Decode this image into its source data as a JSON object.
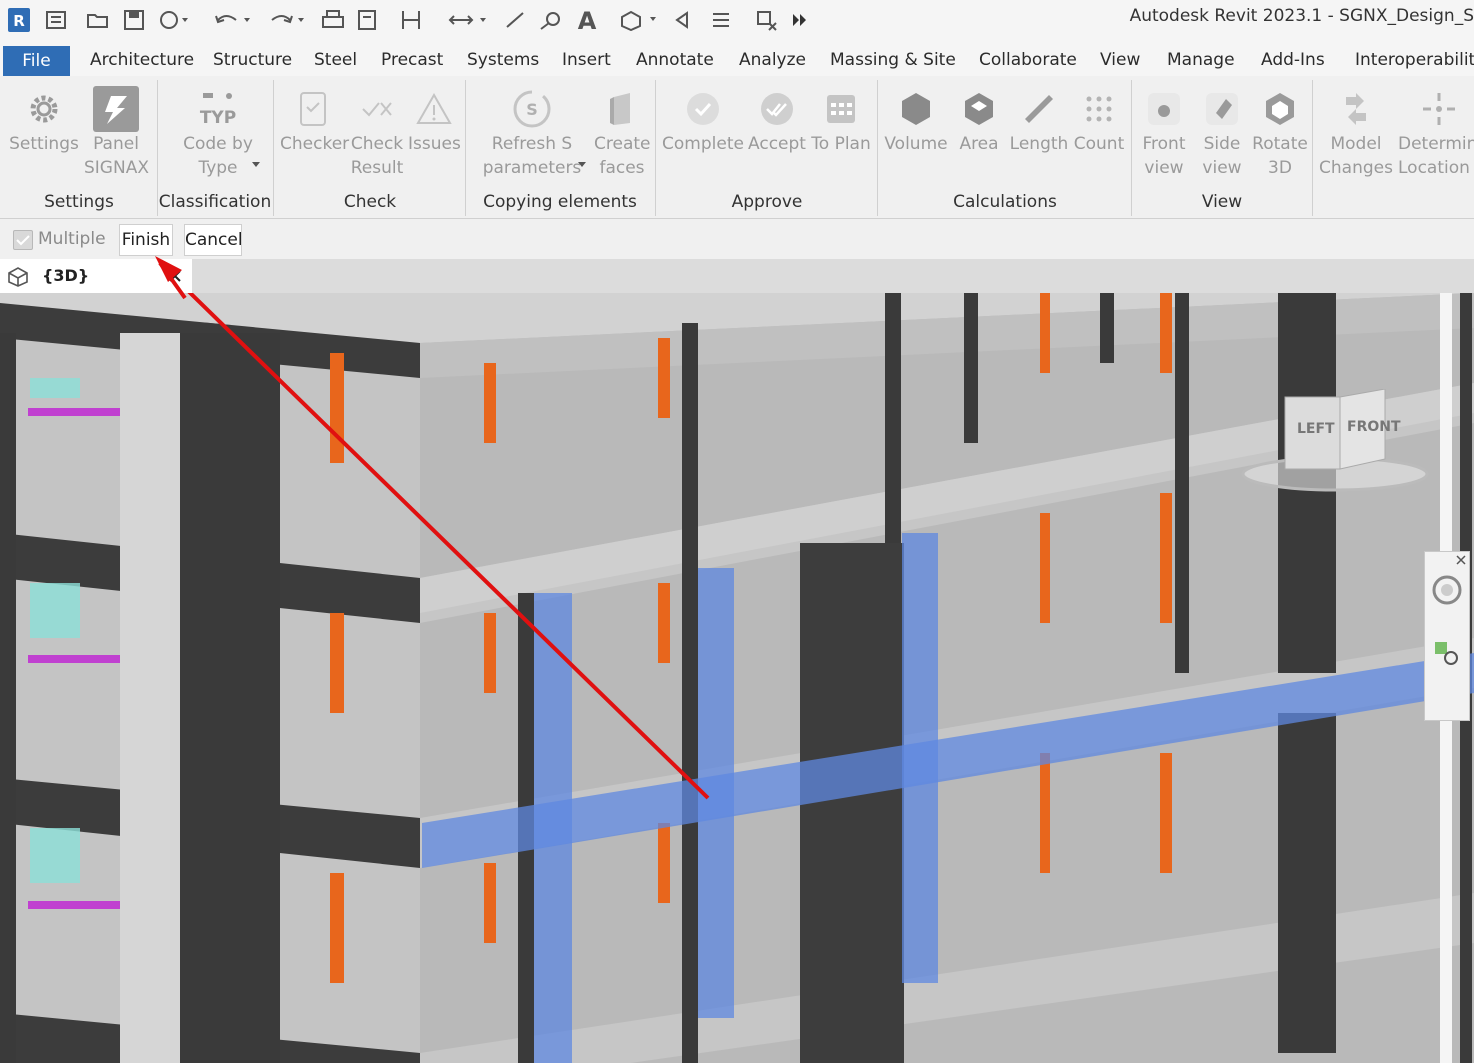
{
  "window": {
    "title": "Autodesk Revit 2023.1 - SGNX_Design_S"
  },
  "app_logo": "R",
  "menu": [
    {
      "label": "File"
    },
    {
      "label": "Architecture"
    },
    {
      "label": "Structure"
    },
    {
      "label": "Steel"
    },
    {
      "label": "Precast"
    },
    {
      "label": "Systems"
    },
    {
      "label": "Insert"
    },
    {
      "label": "Annotate"
    },
    {
      "label": "Analyze"
    },
    {
      "label": "Massing & Site"
    },
    {
      "label": "Collaborate"
    },
    {
      "label": "View"
    },
    {
      "label": "Manage"
    },
    {
      "label": "Add-Ins"
    },
    {
      "label": "Interoperability"
    }
  ],
  "ribbon": {
    "panels": [
      {
        "title": "Settings"
      },
      {
        "title": "Classification"
      },
      {
        "title": "Check"
      },
      {
        "title": "Copying elements"
      },
      {
        "title": "Approve"
      },
      {
        "title": "Calculations"
      },
      {
        "title": "View"
      }
    ],
    "tools": [
      {
        "line1": "Settings",
        "line2": "",
        "icon": "gear-icon"
      },
      {
        "line1": "Panel",
        "line2": "SIGNAX",
        "icon": "signax-logo-icon"
      },
      {
        "line1": "Code by",
        "line2": "Type",
        "icon": "typ-icon"
      },
      {
        "line1": "Checker",
        "line2": "",
        "icon": "checker-icon"
      },
      {
        "line1": "Check",
        "line2": "Result",
        "icon": "check-result-icon"
      },
      {
        "line1": "Issues",
        "line2": "",
        "icon": "warning-icon"
      },
      {
        "line1": "Refresh S",
        "line2": "parameters",
        "icon": "refresh-s-icon"
      },
      {
        "line1": "Create",
        "line2": "faces",
        "icon": "faces-icon"
      },
      {
        "line1": "Complete",
        "line2": "",
        "icon": "complete-icon"
      },
      {
        "line1": "Accept",
        "line2": "",
        "icon": "accept-icon"
      },
      {
        "line1": "To Plan",
        "line2": "",
        "icon": "calendar-icon"
      },
      {
        "line1": "Volume",
        "line2": "",
        "icon": "hexagon-icon"
      },
      {
        "line1": "Area",
        "line2": "",
        "icon": "area-icon"
      },
      {
        "line1": "Length",
        "line2": "",
        "icon": "ruler-icon"
      },
      {
        "line1": "Count",
        "line2": "",
        "icon": "dots-grid-icon"
      },
      {
        "line1": "Front",
        "line2": "view",
        "icon": "front-view-icon"
      },
      {
        "line1": "Side",
        "line2": "view",
        "icon": "side-view-icon"
      },
      {
        "line1": "Rotate",
        "line2": "3D",
        "icon": "rotate-3d-icon"
      },
      {
        "line1": "Model",
        "line2": "Changes",
        "icon": "model-changes-icon"
      },
      {
        "line1": "Determine",
        "line2": "Location",
        "icon": "location-icon"
      }
    ]
  },
  "options_bar": {
    "multiple_label": "Multiple",
    "finish_label": "Finish",
    "cancel_label": "Cancel"
  },
  "view_tab": {
    "label": "{3D}"
  },
  "viewcube": {
    "left": "LEFT",
    "front": "FRONT"
  },
  "colors": {
    "accent": "#2f6db5",
    "arrow": "#e01010",
    "selection": "#5f88e0",
    "pipe": "#e8661c"
  }
}
